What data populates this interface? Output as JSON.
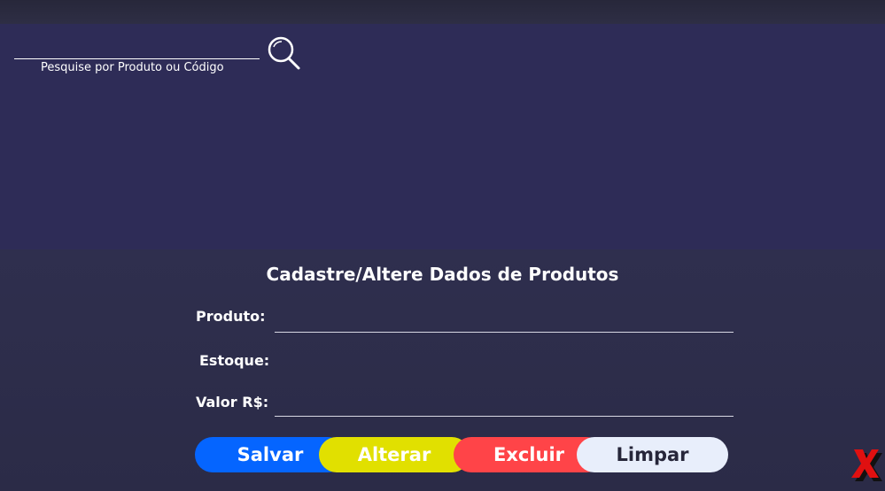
{
  "search": {
    "placeholder": "Pesquise por Produto ou Código",
    "icon": "search-icon"
  },
  "form": {
    "title": "Cadastre/Altere Dados de Produtos",
    "fields": {
      "produto_label": "Produto:",
      "estoque_label": "Estoque:",
      "valor_label": "Valor R$:"
    }
  },
  "buttons": {
    "salvar": "Salvar",
    "alterar": "Alterar",
    "excluir": "Excluir",
    "limpar": "Limpar"
  },
  "colors": {
    "salvar": "#0565ff",
    "alterar": "#e1e000",
    "excluir": "#ff4448",
    "limpar": "#e8eefb",
    "close_icon": "#e01010"
  },
  "close": {
    "icon": "close-icon"
  }
}
